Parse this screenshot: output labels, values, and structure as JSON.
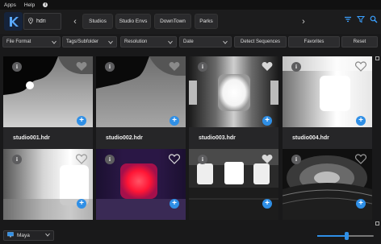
{
  "menu": {
    "apps": "Apps",
    "help": "Help"
  },
  "search": {
    "value": "hdri"
  },
  "nav": {
    "back": "‹",
    "forward": "›"
  },
  "chips": [
    "Studios",
    "Studio Envs",
    "DownTown",
    "Parks"
  ],
  "filters": {
    "file_format": "File Format",
    "tags": "Tags/Subfolder",
    "resolution": "Resolution",
    "date": "Date",
    "detect": "Detect Sequences",
    "favorites": "Favorites",
    "reset": "Reset"
  },
  "cards": [
    {
      "name": "studio001.hdr",
      "info": "i",
      "plus": "+"
    },
    {
      "name": "studio002.hdr",
      "info": "i",
      "plus": "+"
    },
    {
      "name": "studio003.hdr",
      "info": "i",
      "plus": "+"
    },
    {
      "name": "studio004.hdr",
      "info": "i",
      "plus": "+"
    },
    {
      "name": "",
      "info": "i",
      "plus": "+"
    },
    {
      "name": "",
      "info": "i",
      "plus": "+"
    },
    {
      "name": "",
      "info": "i",
      "plus": "+"
    },
    {
      "name": "",
      "info": "i",
      "plus": "+"
    }
  ],
  "dcc": {
    "value": "Maya"
  },
  "thumb_size": {
    "value": 0.52
  },
  "colors": {
    "accent": "#2f8fe6",
    "logo": "#5aa9ff",
    "heart_active": "#d8d8d8",
    "heart_dim": "#8a8a8a"
  }
}
